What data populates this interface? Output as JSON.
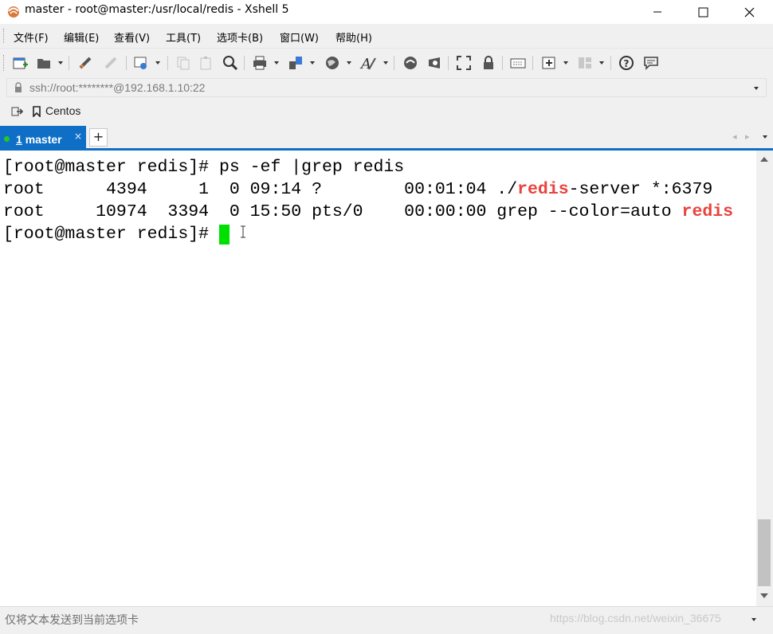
{
  "window": {
    "title": "master - root@master:/usr/local/redis - Xshell 5"
  },
  "menu": {
    "items": [
      {
        "label": "文件(F)"
      },
      {
        "label": "编辑(E)"
      },
      {
        "label": "查看(V)"
      },
      {
        "label": "工具(T)"
      },
      {
        "label": "选项卡(B)"
      },
      {
        "label": "窗口(W)"
      },
      {
        "label": "帮助(H)"
      }
    ]
  },
  "address": {
    "value": "ssh://root:********@192.168.1.10:22"
  },
  "links": {
    "item": "Centos"
  },
  "tabs": {
    "active_number": "1",
    "active_label": "master",
    "close": "×",
    "add": "+"
  },
  "terminal": {
    "line1": "[root@master redis]# ps -ef |grep redis",
    "line2_pre": "root      4394     1  0 09:14 ?        00:01:04 ./",
    "line2_red": "redis",
    "line2_post": "-server *:6379",
    "line3_pre": "root     10974  3394  0 15:50 pts/0    00:00:00 grep --color=auto ",
    "line3_red": "redis",
    "line4": "[root@master redis]# "
  },
  "status": {
    "text": "仅将文本发送到当前选项卡",
    "watermark": "https://blog.csdn.net/weixin_36675"
  },
  "colors": {
    "accent": "#0f6fc6",
    "highlight": "#e8433d",
    "cursor": "#00e000"
  }
}
